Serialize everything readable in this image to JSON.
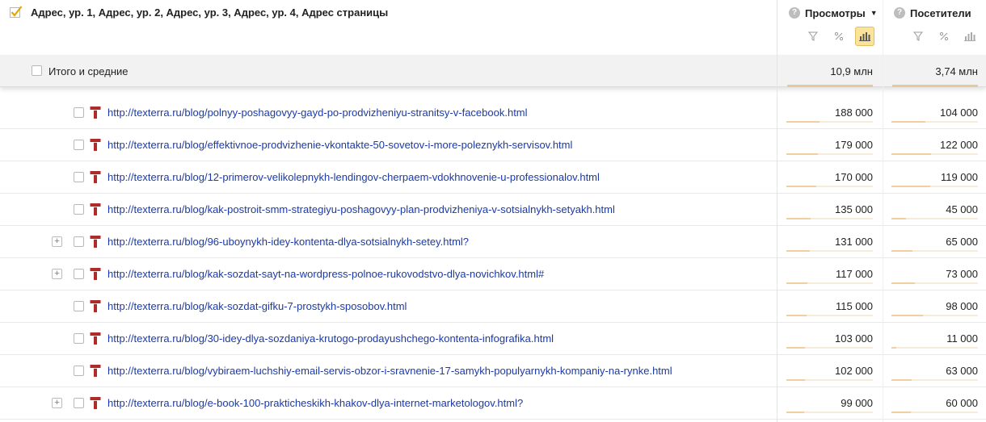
{
  "header": {
    "dimension_title": "Адрес, ур. 1, Адрес, ур. 2, Адрес, ур. 3, Адрес, ур. 4, Адрес страницы",
    "metrics": [
      {
        "label": "Просмотры",
        "sort": "▼"
      },
      {
        "label": "Посетители"
      }
    ],
    "help_glyph": "?"
  },
  "totals": {
    "label": "Итого и средние",
    "pageviews": "10,9 млн",
    "visitors": "3,74 млн"
  },
  "colors": {
    "link": "#1a3aa8",
    "site_icon": "#b02a2a",
    "bar": "#f2cfa3",
    "active_tool": "#fbe39a"
  },
  "rows": [
    {
      "url": "http://texterra.ru/blog/polnyy-poshagovyy-gayd-po-prodvizheniyu-stranitsy-v-facebook.html",
      "pageviews": "188 000",
      "visitors": "104 000",
      "expand": false,
      "pv_share": 0.0172,
      "v_share": 0.0278
    },
    {
      "url": "http://texterra.ru/blog/effektivnoe-prodvizhenie-vkontakte-50-sovetov-i-more-poleznykh-servisov.html",
      "pageviews": "179 000",
      "visitors": "122 000",
      "expand": false,
      "pv_share": 0.0164,
      "v_share": 0.0326
    },
    {
      "url": "http://texterra.ru/blog/12-primerov-velikolepnykh-lendingov-cherpaem-vdokhnovenie-u-professionalov.html",
      "pageviews": "170 000",
      "visitors": "119 000",
      "expand": false,
      "pv_share": 0.0156,
      "v_share": 0.0318
    },
    {
      "url": "http://texterra.ru/blog/kak-postroit-smm-strategiyu-poshagovyy-plan-prodvizheniya-v-sotsialnykh-setyakh.html",
      "pageviews": "135 000",
      "visitors": "45 000",
      "expand": false,
      "pv_share": 0.0124,
      "v_share": 0.012
    },
    {
      "url": "http://texterra.ru/blog/96-uboynykh-idey-kontenta-dlya-sotsialnykh-setey.html?",
      "pageviews": "131 000",
      "visitors": "65 000",
      "expand": true,
      "pv_share": 0.012,
      "v_share": 0.0174
    },
    {
      "url": "http://texterra.ru/blog/kak-sozdat-sayt-na-wordpress-polnoe-rukovodstvo-dlya-novichkov.html#",
      "pageviews": "117 000",
      "visitors": "73 000",
      "expand": true,
      "pv_share": 0.0107,
      "v_share": 0.0195
    },
    {
      "url": "http://texterra.ru/blog/kak-sozdat-gifku-7-prostykh-sposobov.html",
      "pageviews": "115 000",
      "visitors": "98 000",
      "expand": false,
      "pv_share": 0.0106,
      "v_share": 0.0262
    },
    {
      "url": "http://texterra.ru/blog/30-idey-dlya-sozdaniya-krutogo-prodayushchego-kontenta-infografika.html",
      "pageviews": "103 000",
      "visitors": "11 000",
      "expand": false,
      "pv_share": 0.0094,
      "v_share": 0.0029
    },
    {
      "url": "http://texterra.ru/blog/vybiraem-luchshiy-email-servis-obzor-i-sravnenie-17-samykh-populyarnykh-kompaniy-na-rynke.html",
      "pageviews": "102 000",
      "visitors": "63 000",
      "expand": false,
      "pv_share": 0.0094,
      "v_share": 0.0168
    },
    {
      "url": "http://texterra.ru/blog/e-book-100-prakticheskikh-khakov-dlya-internet-marketologov.html?",
      "pageviews": "99 000",
      "visitors": "60 000",
      "expand": true,
      "pv_share": 0.0091,
      "v_share": 0.016
    }
  ]
}
